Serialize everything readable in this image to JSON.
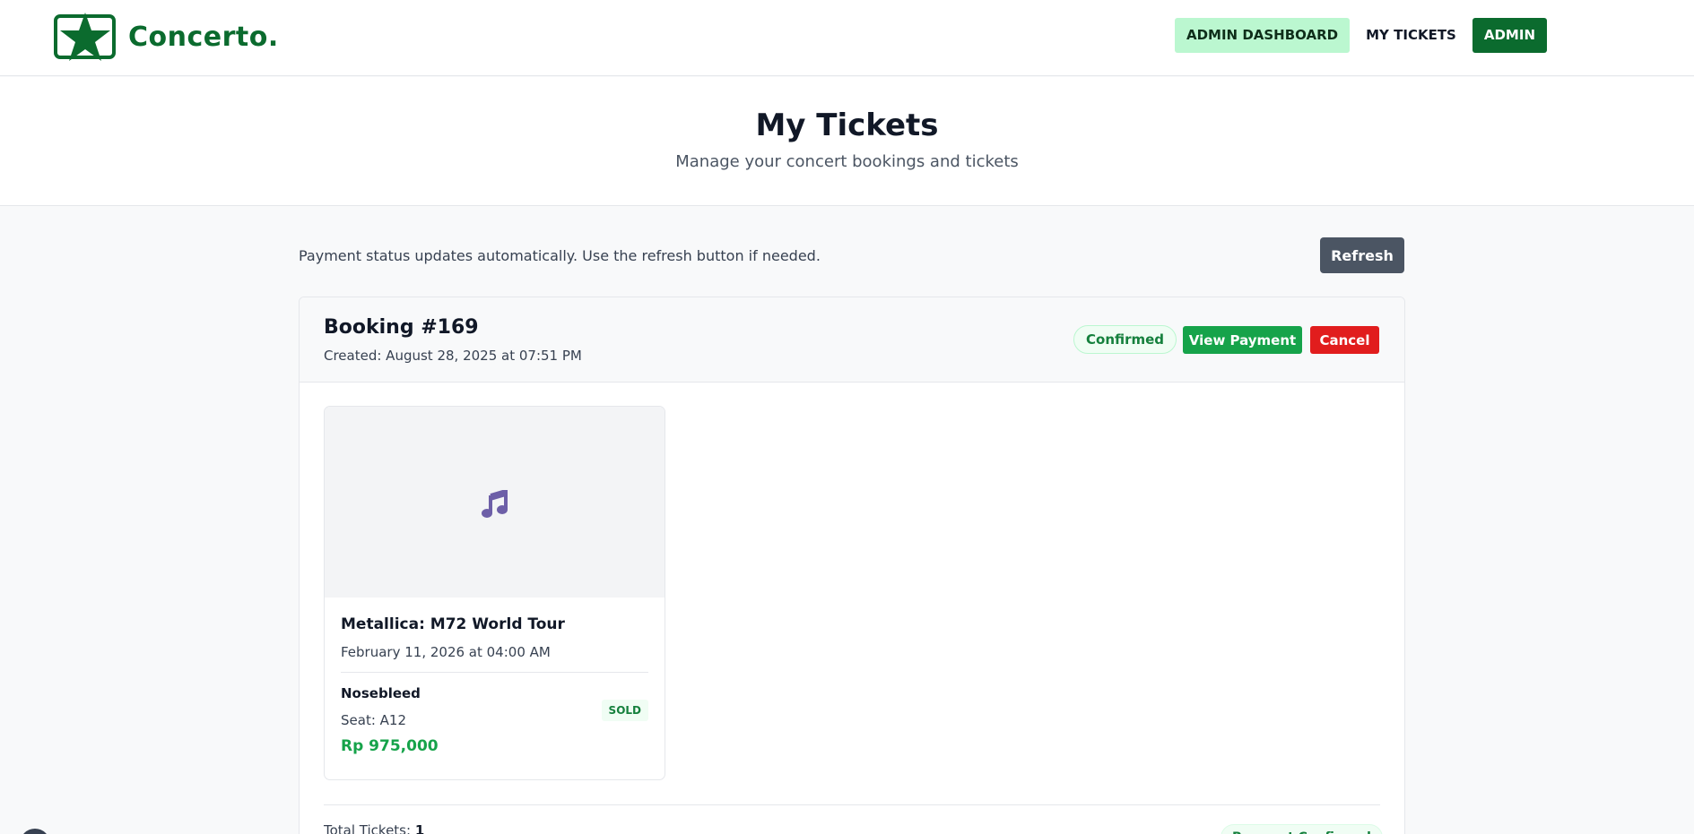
{
  "brand": {
    "name": "Concerto.",
    "color": "#0b6b2e",
    "icon": "star-icon"
  },
  "nav": {
    "admin_dashboard": "ADMIN DASHBOARD",
    "my_tickets": "MY TICKETS",
    "admin": "ADMIN"
  },
  "hero": {
    "title": "My Tickets",
    "subtitle": "Manage your concert bookings and tickets"
  },
  "notice": {
    "text": "Payment status updates automatically. Use the refresh button if needed.",
    "refresh_label": "Refresh"
  },
  "booking": {
    "title": "Booking #169",
    "created": "Created: August 28, 2025 at 07:51 PM",
    "status": "Confirmed",
    "view_payment_label": "View Payment",
    "cancel_label": "Cancel",
    "ticket": {
      "image_icon": "music-note-icon",
      "title": "Metallica: M72 World Tour",
      "date": "February 11, 2026 at 04:00 AM",
      "section": "Nosebleed",
      "badge": "SOLD",
      "seat": "Seat: A12",
      "price": "Rp 975,000"
    },
    "total_label": "Total Tickets:",
    "total_count": "1",
    "payment_status": "Payment Confirmed"
  },
  "colors": {
    "accent": "#0b6b2e",
    "success": "#16a34a",
    "danger": "#e11d1d",
    "neutral_button": "#4b5563"
  }
}
